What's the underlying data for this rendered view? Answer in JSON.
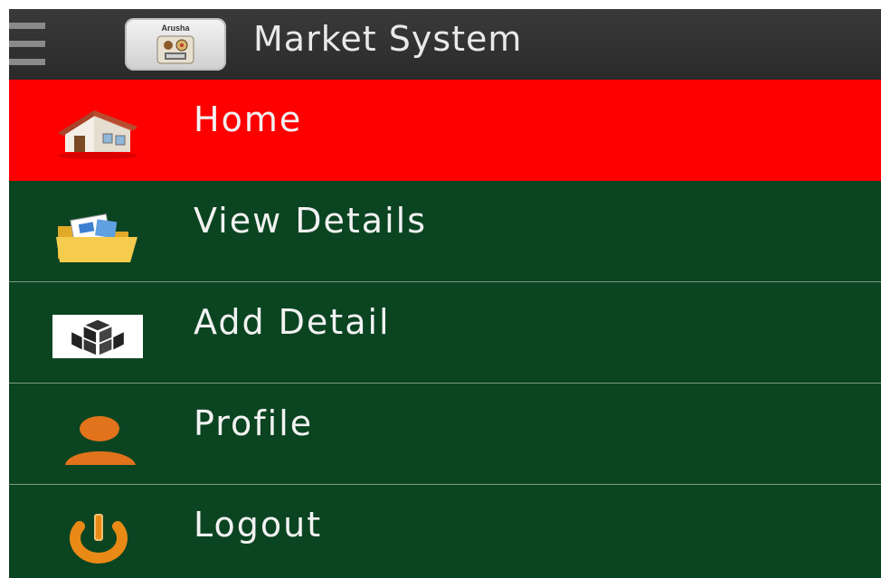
{
  "window": {
    "title": "Market System",
    "app_icon": {
      "name": "arusha-market-icon",
      "text": "Arusha"
    }
  },
  "colors": {
    "appbar": "#2f2f2f",
    "active_item": "#ff0000",
    "menu_item": "#0b4421",
    "text": "#f2f2f2"
  },
  "menu": {
    "items": [
      {
        "label": "Home",
        "icon": "house-icon",
        "active": true
      },
      {
        "label": "View Details",
        "icon": "folder-icon",
        "active": false
      },
      {
        "label": "Add Detail",
        "icon": "boxes-icon",
        "active": false
      },
      {
        "label": "Profile",
        "icon": "person-icon",
        "active": false
      },
      {
        "label": "Logout",
        "icon": "power-icon",
        "active": false
      }
    ]
  }
}
